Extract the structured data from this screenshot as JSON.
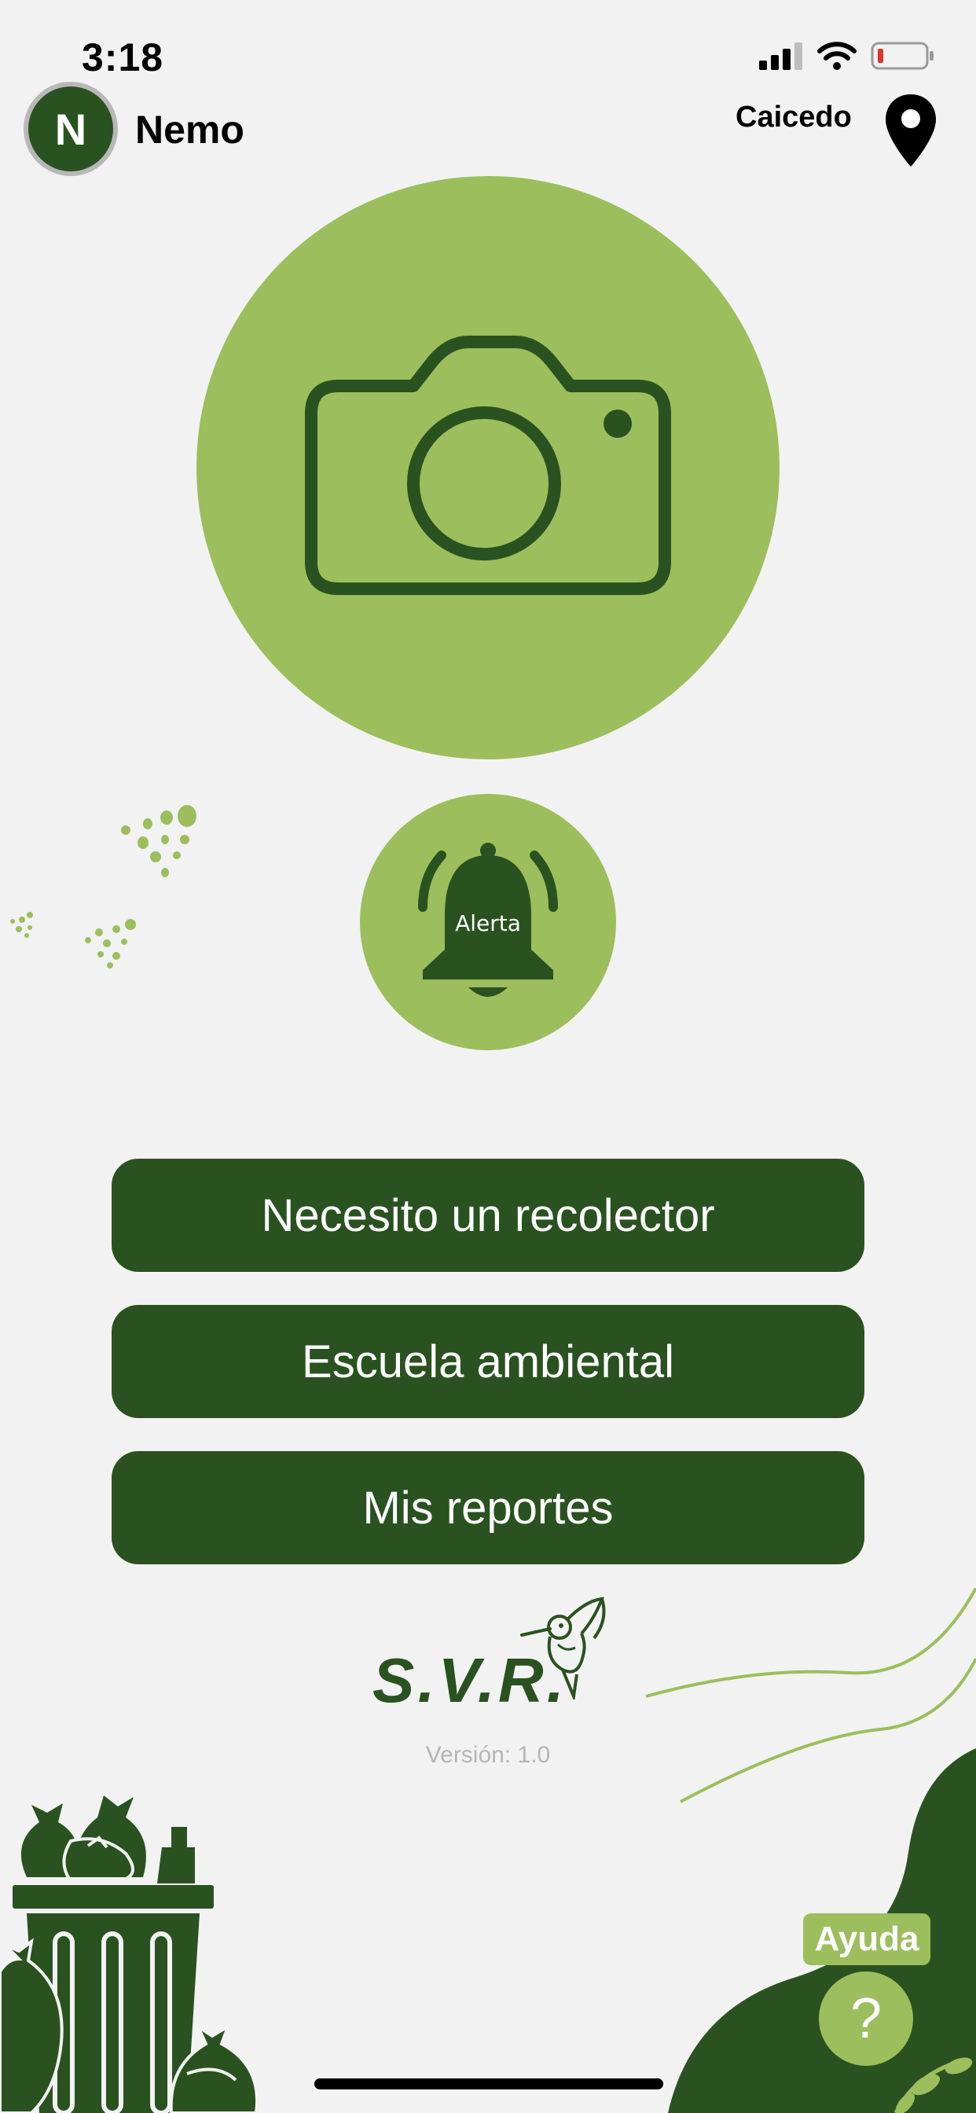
{
  "status_bar": {
    "time": "3:18"
  },
  "header": {
    "avatar_initial": "N",
    "username": "Nemo",
    "location": "Caicedo"
  },
  "camera": {
    "icon": "camera-icon"
  },
  "alert": {
    "label": "Alerta",
    "icon": "bell-icon"
  },
  "actions": [
    {
      "label": "Necesito un recolector"
    },
    {
      "label": "Escuela ambiental"
    },
    {
      "label": "Mis reportes"
    }
  ],
  "logo": {
    "text": "S.V.R."
  },
  "version": "Versión: 1.0",
  "help": {
    "label": "Ayuda",
    "symbol": "?"
  },
  "colors": {
    "dark_green": "#2a5220",
    "light_green": "#9cbe5c",
    "background": "#f2f2f2"
  }
}
